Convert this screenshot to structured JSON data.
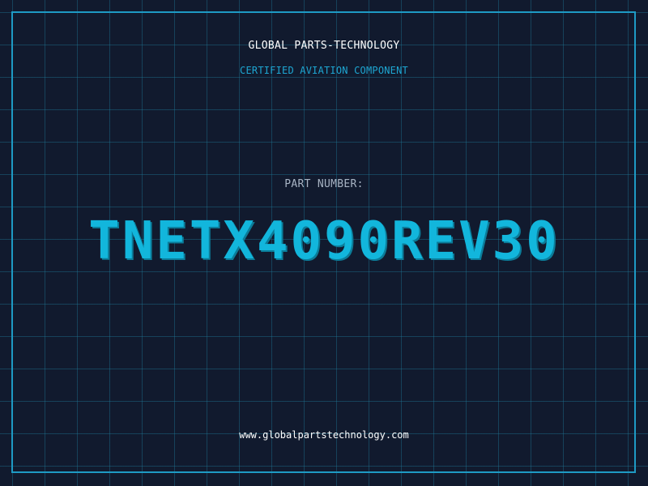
{
  "header": {
    "company": "GLOBAL PARTS-TECHNOLOGY",
    "subtitle": "CERTIFIED AVIATION COMPONENT"
  },
  "part": {
    "label": "PART NUMBER:",
    "number": "TNETX4090REV30"
  },
  "footer": {
    "website": "www.globalpartstechnology.com"
  },
  "colors": {
    "background": "#111a2e",
    "grid": "#1e7896",
    "frame": "#1e9ac4",
    "accent": "#12b6dc",
    "label": "#a8b4c4",
    "text": "#ffffff"
  }
}
